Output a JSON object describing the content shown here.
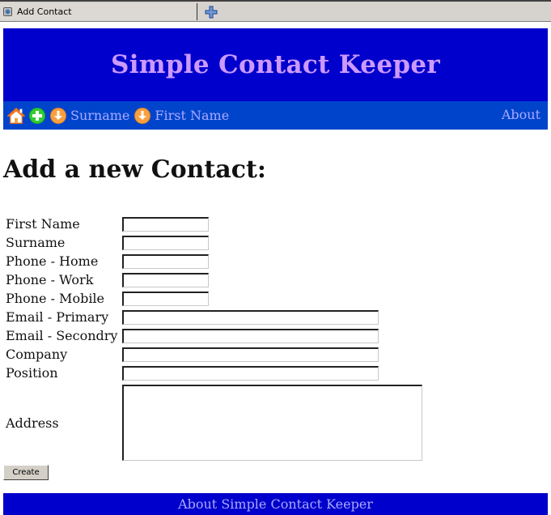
{
  "browser": {
    "tab_title": "Add Contact",
    "new_tab_icon": "plus-icon",
    "favicon": "page-icon"
  },
  "header": {
    "title": "Simple Contact Keeper"
  },
  "nav": {
    "home_icon": "home-icon",
    "add_icon": "add-icon",
    "sort_icon": "sort-down-icon",
    "sort_surname_label": "Surname",
    "sort_firstname_label": "First Name",
    "about_label": "About"
  },
  "colors": {
    "header_bg": "#0000cc",
    "nav_bg": "#0044cc",
    "title_text": "#cc99ff",
    "nav_text": "#aaaaff"
  },
  "main": {
    "heading": "Add a new Contact:",
    "fields": [
      {
        "label": "First Name",
        "value": ""
      },
      {
        "label": "Surname",
        "value": ""
      },
      {
        "label": "Phone - Home",
        "value": ""
      },
      {
        "label": "Phone - Work",
        "value": ""
      },
      {
        "label": "Phone - Mobile",
        "value": ""
      },
      {
        "label": "Email - Primary",
        "value": ""
      },
      {
        "label": "Email - Secondry",
        "value": ""
      },
      {
        "label": "Company",
        "value": ""
      },
      {
        "label": "Position",
        "value": ""
      },
      {
        "label": "Address",
        "value": ""
      }
    ],
    "create_label": "Create"
  },
  "footer": {
    "link_label": "About Simple Contact Keeper"
  }
}
